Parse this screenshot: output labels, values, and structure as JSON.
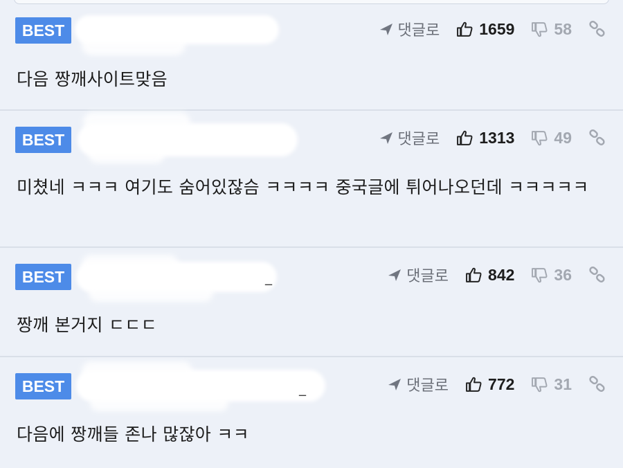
{
  "colors": {
    "badge": "#4d8be8",
    "background": "#edf1f8",
    "divider": "#d9dfe8",
    "muted": "#a3a8b1"
  },
  "icons": {
    "reply": "arrow-reply-icon",
    "like": "thumbs-up-icon",
    "dislike": "thumbs-down-icon",
    "link": "link-icon"
  },
  "comments": [
    {
      "badge": "BEST",
      "author": "",
      "reply_label": "댓글로",
      "likes": "1659",
      "dislikes": "58",
      "text": "다음 짱깨사이트맞음"
    },
    {
      "badge": "BEST",
      "author": "",
      "reply_label": "댓글로",
      "likes": "1313",
      "dislikes": "49",
      "text": "미쳤네 ㅋㅋㅋ 여기도 숨어있잖슴 ㅋㅋㅋㅋ 중국글에 튀어나오던데 ㅋㅋㅋㅋㅋ"
    },
    {
      "badge": "BEST",
      "author": "",
      "reply_label": "댓글로",
      "likes": "842",
      "dislikes": "36",
      "text": "짱깨 본거지 ㄷㄷㄷ"
    },
    {
      "badge": "BEST",
      "author": "",
      "reply_label": "댓글로",
      "likes": "772",
      "dislikes": "31",
      "text": "다음에 짱깨들 존나 많잖아 ㅋㅋ"
    }
  ]
}
